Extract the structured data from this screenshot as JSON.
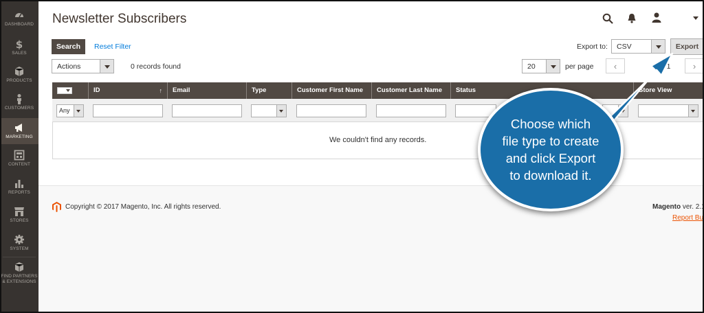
{
  "sidebar": {
    "items": [
      {
        "label": "DASHBOARD",
        "icon": "dashboard-icon"
      },
      {
        "label": "SALES",
        "icon": "dollar-icon"
      },
      {
        "label": "PRODUCTS",
        "icon": "cube-icon"
      },
      {
        "label": "CUSTOMERS",
        "icon": "person-icon"
      },
      {
        "label": "MARKETING",
        "icon": "megaphone-icon",
        "active": true
      },
      {
        "label": "CONTENT",
        "icon": "layout-icon"
      },
      {
        "label": "REPORTS",
        "icon": "bar-chart-icon"
      },
      {
        "label": "STORES",
        "icon": "store-icon"
      },
      {
        "label": "SYSTEM",
        "icon": "gear-icon"
      },
      {
        "label_line1": "FIND PARTNERS",
        "label_line2": "& EXTENSIONS",
        "icon": "box-icon"
      }
    ]
  },
  "header": {
    "title": "Newsletter Subscribers",
    "icons": [
      "search-icon",
      "bell-icon",
      "user-icon",
      "caret-down-icon"
    ]
  },
  "toolbar": {
    "search_label": "Search",
    "reset_filter_label": "Reset Filter",
    "export_to_label": "Export to:",
    "export_format": "CSV",
    "export_label": "Export",
    "actions_label": "Actions",
    "records_found": "0 records found",
    "per_page_value": "20",
    "per_page_label": "per page",
    "page_of": "of 1"
  },
  "grid": {
    "columns": [
      "ID",
      "Email",
      "Type",
      "Customer First Name",
      "Customer Last Name",
      "Status",
      "Store View"
    ],
    "massaction_filter": "Any",
    "empty_message": "We couldn't find any records."
  },
  "footer": {
    "copyright": "Copyright © 2017 Magento, Inc. All rights reserved.",
    "brand": "Magento",
    "version": " ver. 2.1",
    "report_bugs": "Report Bu"
  },
  "callout": {
    "lines": [
      "Choose which",
      "file type to create",
      "and click Export",
      "to download it."
    ],
    "color": "#1a6ea8"
  }
}
